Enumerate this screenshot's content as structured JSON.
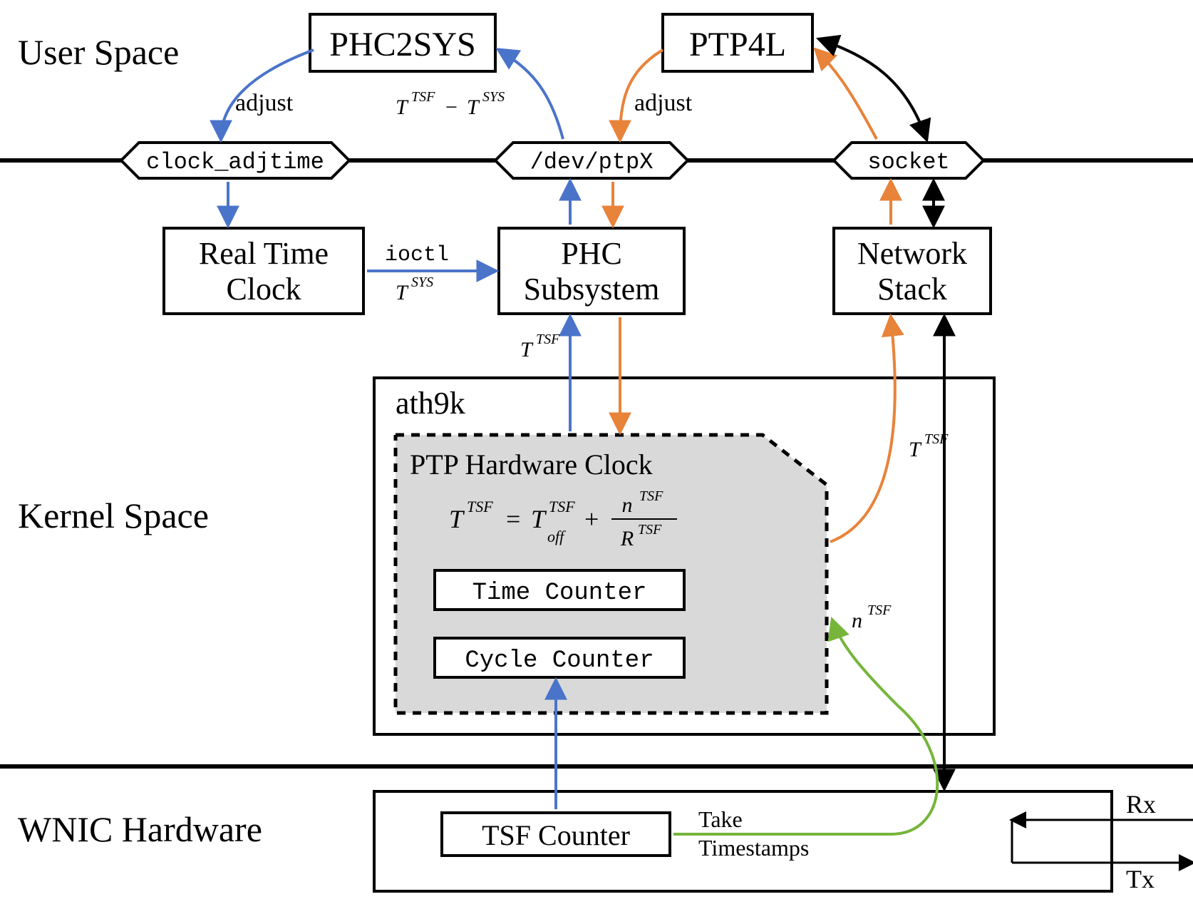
{
  "sections": {
    "user": "User Space",
    "kernel": "Kernel Space",
    "wnic": "WNIC Hardware"
  },
  "boxes": {
    "phc2sys": "PHC2SYS",
    "ptp4l": "PTP4L",
    "clock_adjtime": "clock_adjtime",
    "dev_ptpx": "/dev/ptpX",
    "socket": "socket",
    "rtc1": "Real Time",
    "rtc2": "Clock",
    "phc_sub1": "PHC",
    "phc_sub2": "Subsystem",
    "net1": "Network",
    "net2": "Stack",
    "ath9k": "ath9k",
    "phc_hw": "PTP Hardware  Clock",
    "time_counter": "Time Counter",
    "cycle_counter": "Cycle Counter",
    "tsf": "TSF Counter"
  },
  "labels": {
    "adjust1": "adjust",
    "adjust2": "adjust",
    "ioctl": "ioctl",
    "take1": "Take",
    "take2": "Timestamps",
    "rx": "Rx",
    "tx": "Tx"
  },
  "math": {
    "T": "T",
    "TSF": "TSF",
    "SYS": "SYS",
    "off": "off",
    "n": "n",
    "R": "R",
    "minus": "−",
    "eq": "=",
    "plus": "+"
  }
}
